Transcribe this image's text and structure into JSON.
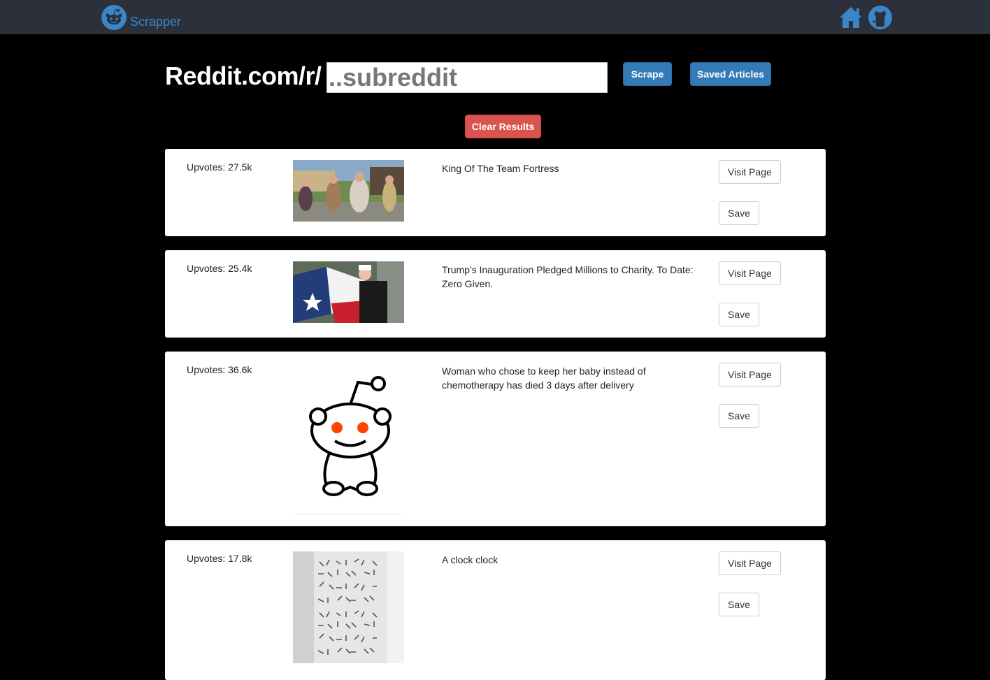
{
  "navbar": {
    "brand": "Scrapper",
    "brand_color": "#3a86c8",
    "icons": [
      "home-icon",
      "github-icon"
    ]
  },
  "search": {
    "prefix": "Reddit.com/r/",
    "placeholder": "..subreddit",
    "scrape_label": "Scrape",
    "saved_label": "Saved Articles",
    "clear_label": "Clear Results"
  },
  "articles": [
    {
      "upvotes": "Upvotes: 27.5k",
      "title": "King Of The Team Fortress",
      "visit_label": "Visit Page",
      "save_label": "Save",
      "thumb": "team-fortress-thumbnail"
    },
    {
      "upvotes": "Upvotes: 25.4k",
      "title": "Trump's Inauguration Pledged Millions to Charity. To Date: Zero Given.",
      "visit_label": "Visit Page",
      "save_label": "Save",
      "thumb": "flag-thumbnail"
    },
    {
      "upvotes": "Upvotes: 36.6k",
      "title": "Woman who chose to keep her baby instead of chemotherapy has died 3 days after delivery",
      "visit_label": "Visit Page",
      "save_label": "Save",
      "thumb": "reddit-alien-thumbnail"
    },
    {
      "upvotes": "Upvotes: 17.8k",
      "title": "A clock clock",
      "visit_label": "Visit Page",
      "save_label": "Save",
      "thumb": "clock-thumbnail"
    }
  ],
  "colors": {
    "primary": "#337ab7",
    "danger": "#d9534f",
    "navbar": "#2b303b",
    "background": "#000000"
  }
}
